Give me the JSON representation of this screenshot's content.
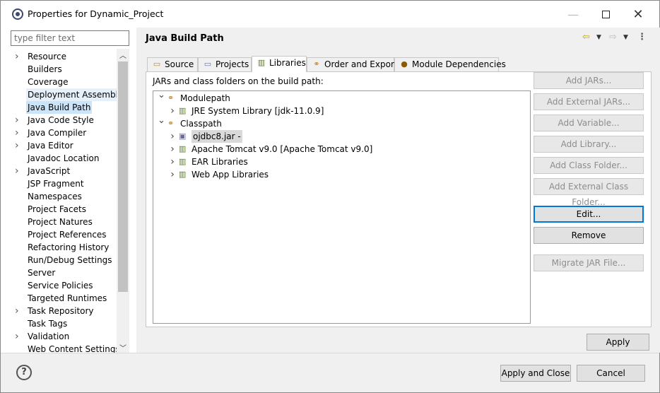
{
  "window": {
    "title": "Properties for Dynamic_Project",
    "controls": {
      "minimize": "—",
      "maximize": "☐",
      "close": "✕"
    }
  },
  "filter": {
    "placeholder": "type filter text",
    "value": ""
  },
  "nav": {
    "items": [
      {
        "label": "Resource",
        "expandable": true
      },
      {
        "label": "Builders",
        "expandable": false
      },
      {
        "label": "Coverage",
        "expandable": false
      },
      {
        "label": "Deployment Assembly",
        "expandable": false,
        "hover": true
      },
      {
        "label": "Java Build Path",
        "expandable": false,
        "selected": true
      },
      {
        "label": "Java Code Style",
        "expandable": true
      },
      {
        "label": "Java Compiler",
        "expandable": true
      },
      {
        "label": "Java Editor",
        "expandable": true
      },
      {
        "label": "Javadoc Location",
        "expandable": false
      },
      {
        "label": "JavaScript",
        "expandable": true
      },
      {
        "label": "JSP Fragment",
        "expandable": false
      },
      {
        "label": "Namespaces",
        "expandable": false
      },
      {
        "label": "Project Facets",
        "expandable": false
      },
      {
        "label": "Project Natures",
        "expandable": false
      },
      {
        "label": "Project References",
        "expandable": false
      },
      {
        "label": "Refactoring History",
        "expandable": false
      },
      {
        "label": "Run/Debug Settings",
        "expandable": false
      },
      {
        "label": "Server",
        "expandable": false
      },
      {
        "label": "Service Policies",
        "expandable": false
      },
      {
        "label": "Targeted Runtimes",
        "expandable": false
      },
      {
        "label": "Task Repository",
        "expandable": true
      },
      {
        "label": "Task Tags",
        "expandable": false
      },
      {
        "label": "Validation",
        "expandable": true
      },
      {
        "label": "Web Content Settings",
        "expandable": false
      }
    ]
  },
  "page": {
    "title": "Java Build Path",
    "tabs": [
      {
        "label": "Source",
        "icon": "source-folder-icon"
      },
      {
        "label": "Projects",
        "icon": "projects-icon"
      },
      {
        "label": "Libraries",
        "icon": "libraries-icon",
        "active": true
      },
      {
        "label": "Order and Export",
        "icon": "order-export-icon"
      },
      {
        "label": "Module Dependencies",
        "icon": "module-dependencies-icon"
      }
    ],
    "content_label": "JARs and class folders on the build path:",
    "tree": [
      {
        "label": "Modulepath",
        "level": 0,
        "expanded": true,
        "icon": "modulepath-icon"
      },
      {
        "label": "JRE System Library [jdk-11.0.9]",
        "level": 1,
        "expanded": false,
        "icon": "library-icon"
      },
      {
        "label": "Classpath",
        "level": 0,
        "expanded": true,
        "icon": "classpath-icon"
      },
      {
        "label": "ojdbc8.jar - ",
        "level": 1,
        "expanded": false,
        "icon": "jar-icon",
        "selected": true
      },
      {
        "label": "Apache Tomcat v9.0 [Apache Tomcat v9.0]",
        "level": 1,
        "expanded": false,
        "icon": "library-icon"
      },
      {
        "label": "EAR Libraries",
        "level": 1,
        "expanded": false,
        "icon": "library-icon"
      },
      {
        "label": "Web App Libraries",
        "level": 1,
        "expanded": false,
        "icon": "library-icon"
      }
    ],
    "buttons": {
      "add_jars": "Add JARs...",
      "add_external_jars": "Add External JARs...",
      "add_variable": "Add Variable...",
      "add_library": "Add Library...",
      "add_class_folder": "Add Class Folder...",
      "add_external_class_folder": "Add External Class Folder...",
      "edit": "Edit...",
      "remove": "Remove",
      "migrate_jar": "Migrate JAR File..."
    },
    "apply": "Apply"
  },
  "footer": {
    "help": "?",
    "apply_and_close": "Apply and Close",
    "cancel": "Cancel"
  }
}
